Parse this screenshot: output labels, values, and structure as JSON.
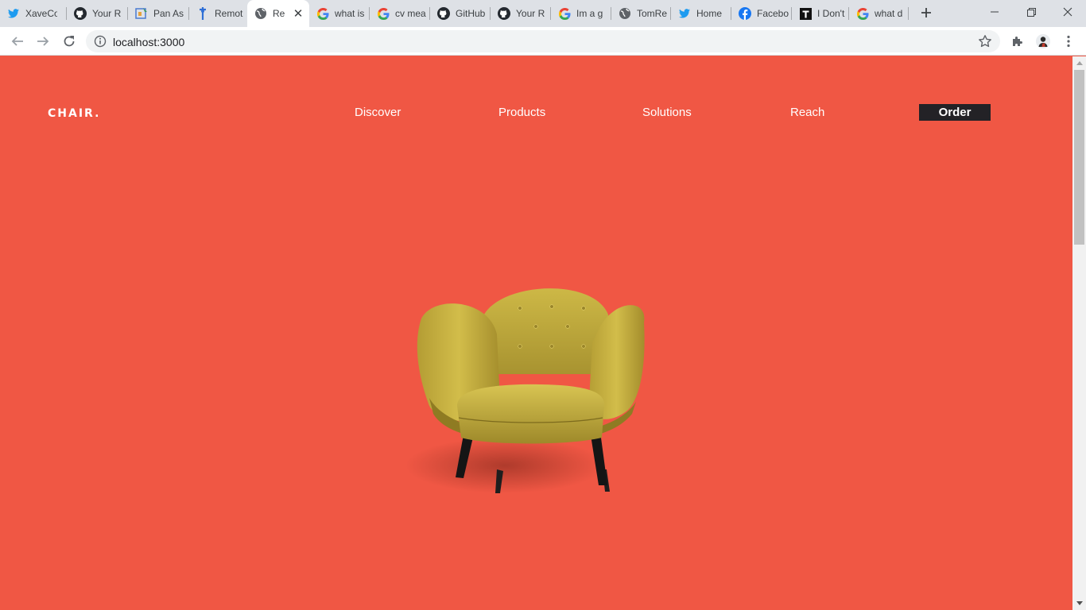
{
  "browser": {
    "tabs": [
      {
        "title": "XaveCo",
        "icon": "twitter-icon"
      },
      {
        "title": "Your R",
        "icon": "github-icon"
      },
      {
        "title": "Pan As",
        "icon": "app-icon"
      },
      {
        "title": "Remot",
        "icon": "remote-icon"
      },
      {
        "title": "Re",
        "icon": "globe-icon",
        "active": true
      },
      {
        "title": "what is",
        "icon": "google-icon"
      },
      {
        "title": "cv mea",
        "icon": "google-icon"
      },
      {
        "title": "GitHub",
        "icon": "github-icon"
      },
      {
        "title": "Your R",
        "icon": "github-icon"
      },
      {
        "title": "Im a g",
        "icon": "google-icon"
      },
      {
        "title": "TomRe",
        "icon": "globe-icon"
      },
      {
        "title": "Home",
        "icon": "twitter-icon"
      },
      {
        "title": "Facebo",
        "icon": "facebook-icon"
      },
      {
        "title": "I Don't",
        "icon": "t-icon"
      },
      {
        "title": "what d",
        "icon": "google-icon"
      }
    ],
    "url": "localhost:3000"
  },
  "site": {
    "brand": "CHAIR.",
    "nav": {
      "discover": "Discover",
      "products": "Products",
      "solutions": "Solutions",
      "reach": "Reach",
      "order": "Order"
    },
    "colors": {
      "background": "#f05744",
      "order_button": "#232226",
      "chair": "#c9b23a"
    }
  }
}
